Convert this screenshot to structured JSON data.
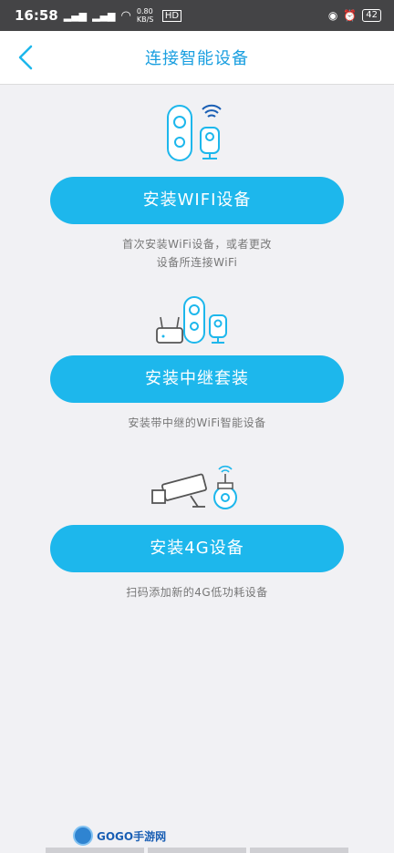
{
  "status": {
    "time": "16:58",
    "network": "5G",
    "network2": "4G",
    "speed": "0.80 KB/S",
    "hd": "HD",
    "battery": "42"
  },
  "nav": {
    "title": "连接智能设备"
  },
  "options": [
    {
      "button": "安装WIFI设备",
      "desc_line1": "首次安装WiFi设备，或者更改",
      "desc_line2": "设备所连接WiFi"
    },
    {
      "button": "安装中继套装",
      "desc_line1": "安装带中继的WiFi智能设备",
      "desc_line2": ""
    },
    {
      "button": "安装4G设备",
      "desc_line1": "扫码添加新的4G低功耗设备",
      "desc_line2": ""
    }
  ],
  "watermark": {
    "text": "GOGO手游网"
  },
  "colors": {
    "accent": "#1db7ec",
    "title": "#1a9fe0",
    "background": "#f1f1f4"
  }
}
